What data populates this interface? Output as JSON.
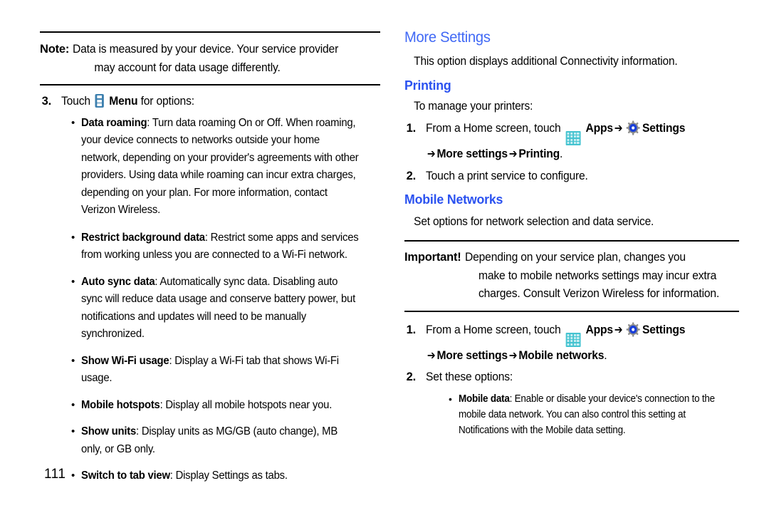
{
  "page": {
    "number": "111"
  },
  "colors": {
    "section_heading": "#4169f5",
    "sub_heading": "#2b52f0",
    "apps_icon": "#44c3d0",
    "menu_icon": "#3c7fae",
    "gear_ring": "#8d8d8d",
    "gear_center": "#1a3fd8"
  },
  "left_column": {
    "note": {
      "label": "Note:",
      "line1": "Data is measured by your device. Your service provider",
      "line2": "may account for data usage differently."
    },
    "step3": {
      "num": "3.",
      "before_icon": "Touch",
      "icon": "menu-icon",
      "after_icon": "Menu",
      "tail": "for options:"
    },
    "bullets": [
      {
        "term": "Data roaming",
        "text": ": Turn data roaming On or Off. When roaming, your device connects to networks outside your home network, depending on your provider's agreements with other providers. Using data while roaming can incur extra charges, depending on your plan. For more information, contact Verizon Wireless."
      },
      {
        "term": "Restrict background data",
        "text": ": Restrict some apps and services from working unless you are connected to a Wi-Fi network."
      },
      {
        "term": "Auto sync data",
        "text": ": Automatically sync data. Disabling auto sync will reduce data usage and conserve battery power, but notifications and updates will need to be manually synchronized."
      },
      {
        "term": "Show Wi-Fi usage",
        "text": ": Display a Wi-Fi tab that shows Wi-Fi usage."
      },
      {
        "term": "Mobile hotspots",
        "text": ": Display all mobile hotspots near you."
      },
      {
        "term": "Show units",
        "text": ": Display units as MG/GB (auto change), MB only, or GB only."
      },
      {
        "term": "Switch to tab view",
        "text": ": Display Settings as tabs."
      }
    ]
  },
  "right_column": {
    "more_settings": {
      "heading": "More Settings",
      "body": "This option displays additional Connectivity information."
    },
    "printing": {
      "heading": "Printing",
      "intro": "To manage your printers:",
      "step1": {
        "num": "1.",
        "lead": "From a Home screen, touch",
        "apps_label": "Apps",
        "arrow": "➔",
        "settings_label": "Settings",
        "path_line": "More settings",
        "path_end": "Printing",
        "period": "."
      },
      "step2": {
        "num": "2.",
        "text": "Touch a print service to configure."
      }
    },
    "mobile_networks": {
      "heading": "Mobile Networks",
      "body": "Set options for network selection and data service.",
      "important": {
        "label": "Important!",
        "line1": "Depending on your service plan, changes you",
        "line2": "make to mobile networks settings may incur extra",
        "line3": "charges. Consult Verizon Wireless for information."
      },
      "step1": {
        "num": "1.",
        "lead": "From a Home screen, touch",
        "apps_label": "Apps",
        "arrow": "➔",
        "settings_label": "Settings",
        "path_line": "More settings",
        "path_end": "Mobile networks",
        "period": "."
      },
      "step2": {
        "num": "2.",
        "text": "Set these options:"
      },
      "bullets": [
        {
          "term": "Mobile data",
          "text": ": Enable or disable your device's connection to the mobile data network. You can also control this setting at Notifications with the Mobile data setting."
        }
      ]
    }
  }
}
